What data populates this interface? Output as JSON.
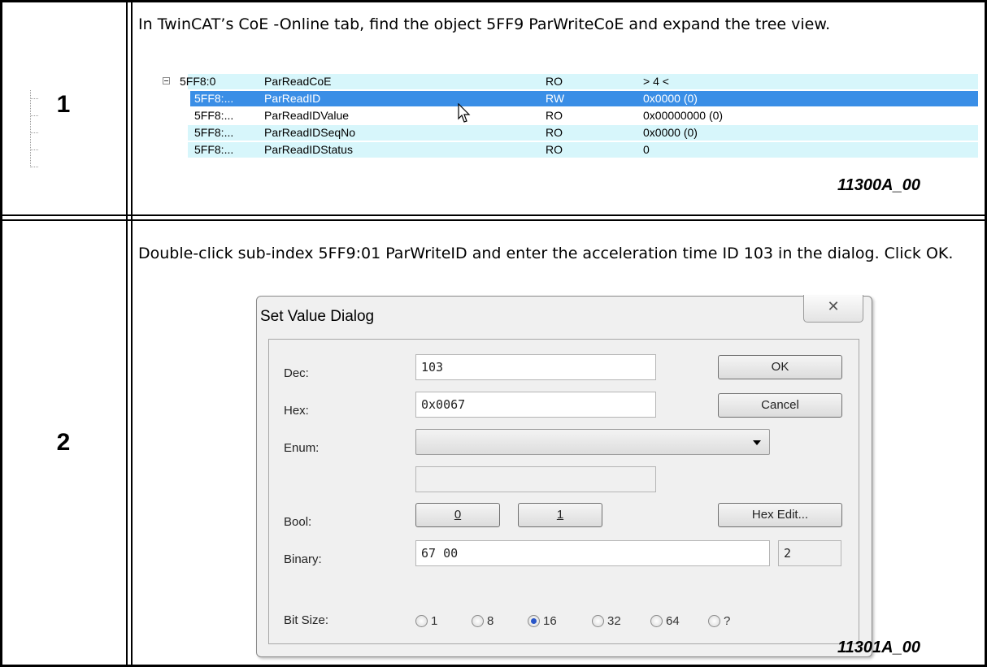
{
  "steps": [
    {
      "number": "1",
      "instruction": "In TwinCAT’s CoE -Online tab, find the object 5FF9 ParWriteCoE and expand the tree view.",
      "figure_id": "11300A_00",
      "tree": {
        "rows": [
          {
            "index": "5FF8:0",
            "name": "ParReadCoE",
            "flags": "RO",
            "value": "> 4 <",
            "selected": false
          },
          {
            "index": "5FF8:...",
            "name": "ParReadID",
            "flags": "RW",
            "value": "0x0000 (0)",
            "selected": true
          },
          {
            "index": "5FF8:...",
            "name": "ParReadIDValue",
            "flags": "RO",
            "value": "0x00000000 (0)",
            "selected": false
          },
          {
            "index": "5FF8:...",
            "name": "ParReadIDSeqNo",
            "flags": "RO",
            "value": "0x0000 (0)",
            "selected": false
          },
          {
            "index": "5FF8:...",
            "name": "ParReadIDStatus",
            "flags": "RO",
            "value": "0",
            "selected": false
          }
        ]
      }
    },
    {
      "number": "2",
      "instruction": "Double-click sub-index 5FF9:01 ParWriteID and enter the acceleration time ID 103 in the dialog. Click OK.",
      "figure_id": "11301A_00",
      "dialog": {
        "title": "Set Value Dialog",
        "close_icon": "✕",
        "dec_label": "Dec:",
        "dec_value": "103",
        "hex_label": "Hex:",
        "hex_value": "0x0067",
        "enum_label": "Enum:",
        "enum_value": "",
        "enum_text": "",
        "bool_label": "Bool:",
        "bool_0": "0",
        "bool_1": "1",
        "binary_label": "Binary:",
        "binary_value": "67 00",
        "binary_length": "2",
        "bitsize_label": "Bit Size:",
        "ok_label": "OK",
        "cancel_label": "Cancel",
        "hexedit_label": "Hex Edit...",
        "bit_sizes": [
          {
            "label": "1",
            "checked": false
          },
          {
            "label": "8",
            "checked": false
          },
          {
            "label": "16",
            "checked": true
          },
          {
            "label": "32",
            "checked": false
          },
          {
            "label": "64",
            "checked": false
          },
          {
            "label": "?",
            "checked": false
          }
        ]
      }
    }
  ]
}
